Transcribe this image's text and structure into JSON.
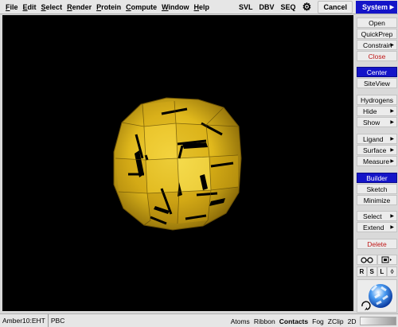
{
  "menubar": {
    "items": [
      "File",
      "Edit",
      "Select",
      "Render",
      "Protein",
      "Compute",
      "Window",
      "Help"
    ],
    "modes": [
      "SVL",
      "DBV",
      "SEQ"
    ],
    "gear_icon": "gear-icon",
    "cancel": "Cancel",
    "system": "System"
  },
  "side_panel": {
    "open": "Open",
    "quickprep": "QuickPrep",
    "constrain": "Constrain",
    "close": "Close",
    "center": "Center",
    "siteview": "SiteView",
    "hydrogens": "Hydrogens",
    "hide": "Hide",
    "show": "Show",
    "ligand": "Ligand",
    "surface": "Surface",
    "measure": "Measure",
    "builder": "Builder",
    "sketch": "Sketch",
    "minimize": "Minimize",
    "select": "Select",
    "extend": "Extend",
    "delete": "Delete",
    "rsl": [
      "R",
      "S",
      "L",
      "◊"
    ],
    "view_icons": [
      "glasses-icon",
      "picture-menu-icon"
    ],
    "orientation_icon": "rotation-sphere-icon"
  },
  "statusbar": {
    "forcefield": "Amber10:EHT",
    "pbc": "PBC",
    "right_items": [
      "Atoms",
      "Ribbon",
      "Contacts",
      "Fog",
      "ZClip",
      "2D"
    ],
    "bold_item": "Contacts"
  },
  "colors": {
    "accent_blue": "#1414c8",
    "delete_red": "#c01818",
    "viewport_bg": "#000000",
    "sphere_gold": "#e8c020"
  }
}
